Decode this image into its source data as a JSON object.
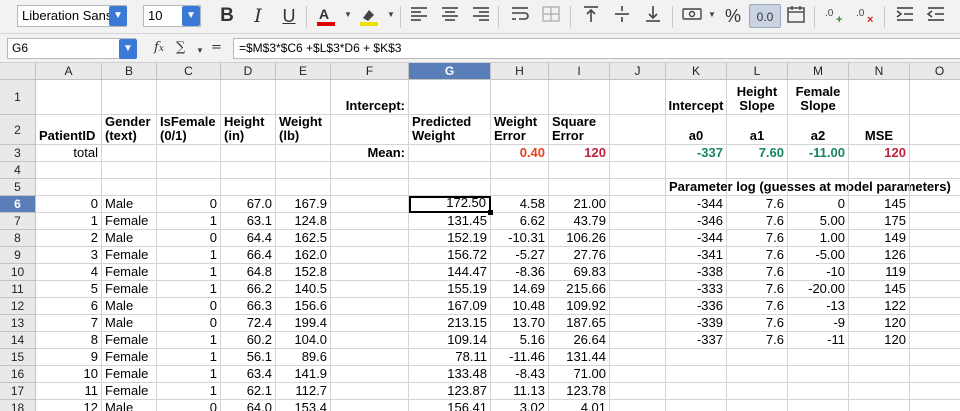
{
  "toolbar": {
    "font_name": "Liberation Sans",
    "font_size": "10",
    "bold_label": "B",
    "italic_label": "I",
    "underline_label": "U",
    "percent_label": "%",
    "decimals_label": "0.0",
    "icons": [
      "font-color-icon",
      "highlight-icon",
      "align-left-icon",
      "align-center-icon",
      "align-right-icon",
      "wrap-icon",
      "merge-icon",
      "align-top-icon",
      "align-middle-icon",
      "align-bottom-icon",
      "currency-icon",
      "percent-icon",
      "number-format-icon",
      "date-format-icon",
      "add-decimal-icon",
      "delete-decimal-icon",
      "indent-icon",
      "outdent-icon"
    ]
  },
  "formula_bar": {
    "cell_ref": "G6",
    "formula": "=$M$3*$C6 +$L$3*D6  + $K$3"
  },
  "columns": [
    "A",
    "B",
    "C",
    "D",
    "E",
    "F",
    "G",
    "H",
    "I",
    "J",
    "K",
    "L",
    "M",
    "N",
    "O"
  ],
  "selected_column": "G",
  "selected_row": "6",
  "headers": {
    "row1": {
      "F": "Intercept:",
      "K": "Intercept",
      "L": "Height\nSlope",
      "M": "Female\nSlope"
    },
    "row2": {
      "A": "PatientID",
      "B": "Gender\n(text)",
      "C": "IsFemale\n(0/1)",
      "D": "Height\n(in)",
      "E": "Weight\n(lb)",
      "G": "Predicted\nWeight",
      "H": "Weight\nError",
      "I": "Square\nError",
      "K": "a0",
      "L": "a1",
      "M": "a2",
      "N": "MSE"
    },
    "row3": {
      "A": "total",
      "F": "Mean:",
      "H": "0.40",
      "I": "120",
      "K": "-337",
      "L": "7.60",
      "M": "-11.00",
      "N": "120"
    },
    "row5": {
      "K": "Parameter log (guesses at model parameters)"
    }
  },
  "rows": [
    {
      "n": "6",
      "A": "0",
      "B": "Male",
      "C": "0",
      "D": "67.0",
      "E": "167.9",
      "G": "172.50",
      "H": "4.58",
      "I": "21.00",
      "K": "-344",
      "L": "7.6",
      "M": "0",
      "N": "145"
    },
    {
      "n": "7",
      "A": "1",
      "B": "Female",
      "C": "1",
      "D": "63.1",
      "E": "124.8",
      "G": "131.45",
      "H": "6.62",
      "I": "43.79",
      "K": "-346",
      "L": "7.6",
      "M": "5.00",
      "N": "175"
    },
    {
      "n": "8",
      "A": "2",
      "B": "Male",
      "C": "0",
      "D": "64.4",
      "E": "162.5",
      "G": "152.19",
      "H": "-10.31",
      "I": "106.26",
      "K": "-344",
      "L": "7.6",
      "M": "1.00",
      "N": "149"
    },
    {
      "n": "9",
      "A": "3",
      "B": "Female",
      "C": "1",
      "D": "66.4",
      "E": "162.0",
      "G": "156.72",
      "H": "-5.27",
      "I": "27.76",
      "K": "-341",
      "L": "7.6",
      "M": "-5.00",
      "N": "126"
    },
    {
      "n": "10",
      "A": "4",
      "B": "Female",
      "C": "1",
      "D": "64.8",
      "E": "152.8",
      "G": "144.47",
      "H": "-8.36",
      "I": "69.83",
      "K": "-338",
      "L": "7.6",
      "M": "-10",
      "N": "119"
    },
    {
      "n": "11",
      "A": "5",
      "B": "Female",
      "C": "1",
      "D": "66.2",
      "E": "140.5",
      "G": "155.19",
      "H": "14.69",
      "I": "215.66",
      "K": "-333",
      "L": "7.6",
      "M": "-20.00",
      "N": "145"
    },
    {
      "n": "12",
      "A": "6",
      "B": "Male",
      "C": "0",
      "D": "66.3",
      "E": "156.6",
      "G": "167.09",
      "H": "10.48",
      "I": "109.92",
      "K": "-336",
      "L": "7.6",
      "M": "-13",
      "N": "122"
    },
    {
      "n": "13",
      "A": "7",
      "B": "Male",
      "C": "0",
      "D": "72.4",
      "E": "199.4",
      "G": "213.15",
      "H": "13.70",
      "I": "187.65",
      "K": "-339",
      "L": "7.6",
      "M": "-9",
      "N": "120"
    },
    {
      "n": "14",
      "A": "8",
      "B": "Female",
      "C": "1",
      "D": "60.2",
      "E": "104.0",
      "G": "109.14",
      "H": "5.16",
      "I": "26.64",
      "K": "-337",
      "L": "7.6",
      "M": "-11",
      "N": "120"
    },
    {
      "n": "15",
      "A": "9",
      "B": "Female",
      "C": "1",
      "D": "56.1",
      "E": "89.6",
      "G": "78.11",
      "H": "-11.46",
      "I": "131.44",
      "K": "",
      "L": "",
      "M": "",
      "N": ""
    },
    {
      "n": "16",
      "A": "10",
      "B": "Female",
      "C": "1",
      "D": "63.4",
      "E": "141.9",
      "G": "133.48",
      "H": "-8.43",
      "I": "71.00",
      "K": "",
      "L": "",
      "M": "",
      "N": ""
    },
    {
      "n": "17",
      "A": "11",
      "B": "Female",
      "C": "1",
      "D": "62.1",
      "E": "112.7",
      "G": "123.87",
      "H": "11.13",
      "I": "123.78",
      "K": "",
      "L": "",
      "M": "",
      "N": ""
    },
    {
      "n": "18",
      "A": "12",
      "B": "Male",
      "C": "0",
      "D": "64.0",
      "E": "153.4",
      "G": "156.41",
      "H": "3.02",
      "I": "4.01",
      "K": "",
      "L": "",
      "M": "",
      "N": ""
    }
  ],
  "row_labels": [
    "1",
    "2",
    "3",
    "4",
    "5"
  ]
}
